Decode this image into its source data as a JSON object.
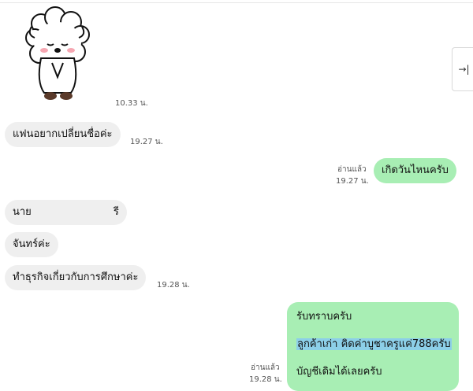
{
  "messages": [
    {
      "id": "sticker",
      "type": "sticker",
      "sticker": "sheep-bowing-sticker",
      "time": "10.33 น."
    },
    {
      "id": "m1",
      "text": "แฟนอยากเปลี่ยนชื่อค่ะ",
      "time": "19.27 น."
    },
    {
      "id": "m2",
      "text": "เกิดวันไหนครับ",
      "read": "อ่านแล้ว",
      "time": "19.27 น."
    },
    {
      "id": "m3",
      "text_start": "นาย",
      "text_end": "รี"
    },
    {
      "id": "m4",
      "text": "จันทร์ค่ะ"
    },
    {
      "id": "m5",
      "text": "ทำธุรกิจเกี่ยวกับการศึกษาค่ะ",
      "time": "19.28 น."
    },
    {
      "id": "m6",
      "lines": [
        "รับทราบครับ",
        "ลูกค้าเก่า คิดค่าบูชาครูแค่788ครับ",
        "บัญชีเดิมได้เลยครับ"
      ],
      "read": "อ่านแล้ว",
      "time": "19.28 น."
    }
  ],
  "panel_toggle": {
    "label": "→|"
  },
  "colors": {
    "incoming_bubble": "#efefef",
    "outgoing_bubble": "#a8eeb4",
    "highlight": "#8ccfe8"
  }
}
